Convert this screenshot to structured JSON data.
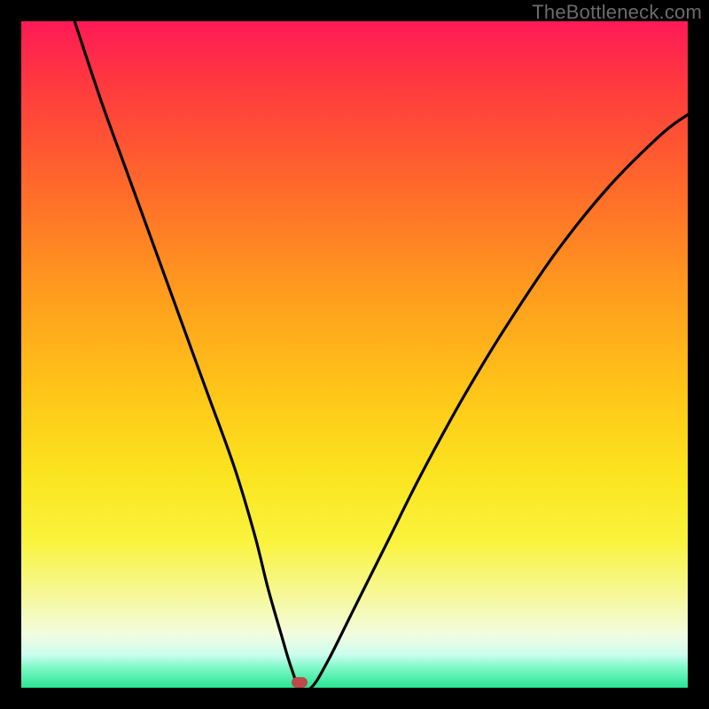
{
  "watermark": "TheBottleneck.com",
  "colors": {
    "frame": "#000000",
    "curve": "#000000",
    "marker": "#c0484a",
    "gradient_top": "#ff1a56",
    "gradient_bottom": "#28e594"
  },
  "marker": {
    "x_pct": 41.8,
    "y_pct": 99.2
  },
  "chart_data": {
    "type": "line",
    "title": "",
    "xlabel": "",
    "ylabel": "",
    "xlim": [
      0,
      100
    ],
    "ylim": [
      0,
      100
    ],
    "grid": false,
    "legend": false,
    "annotations": [
      "TheBottleneck.com"
    ],
    "minimum_point": {
      "x": 41.8,
      "y": 0
    },
    "series": [
      {
        "name": "bottleneck-curve",
        "x": [
          8,
          12,
          16,
          20,
          24,
          28,
          32,
          35,
          37,
          39,
          40.5,
          41.8,
          43.5,
          46,
          50,
          55,
          60,
          66,
          72,
          80,
          88,
          96,
          100
        ],
        "values": [
          100,
          88,
          77,
          66,
          55,
          44,
          33,
          23,
          15,
          8,
          3,
          0,
          0,
          4,
          12,
          22,
          32,
          43,
          53,
          65,
          75,
          83,
          86
        ]
      }
    ]
  }
}
